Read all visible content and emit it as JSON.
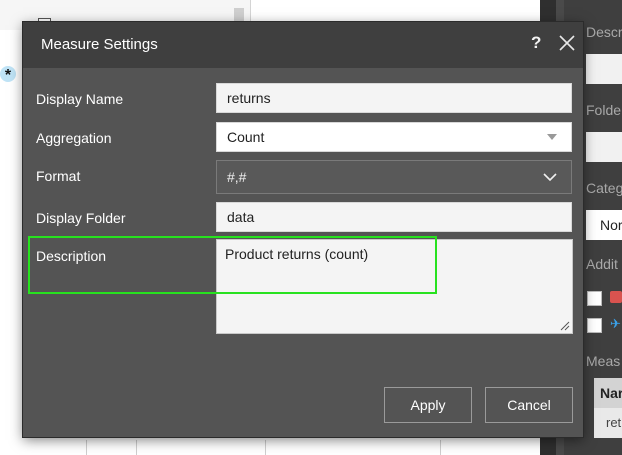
{
  "background": {
    "right_panel": {
      "labels": [
        "Descr",
        "Folde",
        "Categ",
        "Addit",
        "Meas"
      ],
      "category_value": "Nor",
      "grid_header": "Nar",
      "grid_cell": "ret"
    }
  },
  "dialog": {
    "title": "Measure Settings",
    "help_label": "?",
    "fields": {
      "display_name": {
        "label": "Display Name",
        "value": "returns"
      },
      "aggregation": {
        "label": "Aggregation",
        "value": "Count"
      },
      "format": {
        "label": "Format",
        "value": "#,#"
      },
      "display_folder": {
        "label": "Display Folder",
        "value": "data"
      },
      "description": {
        "label": "Description",
        "value": "Product returns (count)"
      }
    },
    "buttons": {
      "apply": "Apply",
      "cancel": "Cancel"
    },
    "highlight_color": "#27e21f"
  }
}
